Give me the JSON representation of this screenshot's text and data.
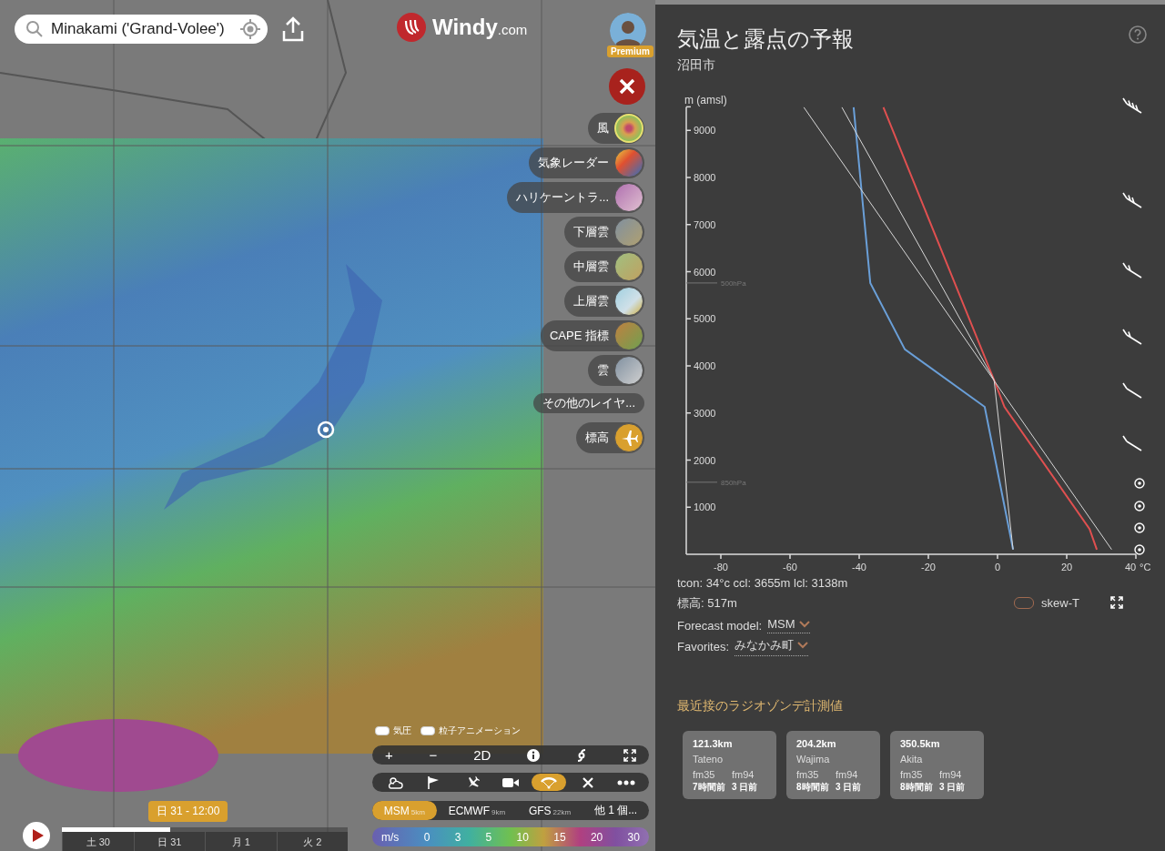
{
  "search": {
    "value": "Minakami ('Grand-Volee')"
  },
  "logo": {
    "name": "Windy",
    "suffix": ".com"
  },
  "account": {
    "badge": "Premium"
  },
  "layers": [
    {
      "kind": "layer",
      "label": "風",
      "selected": true
    },
    {
      "kind": "layer",
      "label": "気象レーダー",
      "selected": false
    },
    {
      "kind": "layer",
      "label": "ハリケーントラ...",
      "selected": false
    },
    {
      "kind": "layer",
      "label": "下層雲",
      "selected": false
    },
    {
      "kind": "layer",
      "label": "中層雲",
      "selected": false
    },
    {
      "kind": "layer",
      "label": "上層雲",
      "selected": false
    },
    {
      "kind": "layer",
      "label": "CAPE 指標",
      "selected": false
    },
    {
      "kind": "layer",
      "label": "雲",
      "selected": false
    },
    {
      "kind": "more",
      "label": "その他のレイヤ...",
      "selected": false
    },
    {
      "kind": "altitude",
      "label": "標高",
      "selected": false
    }
  ],
  "overlays": [
    {
      "label": "気圧",
      "on": true
    },
    {
      "label": "粒子アニメーション",
      "on": true
    }
  ],
  "map_controls": {
    "zoom_in": "+",
    "zoom_out": "−",
    "view_mode": "2D"
  },
  "tools": [
    {
      "kind": "weather",
      "selected": false
    },
    {
      "kind": "flag",
      "selected": false
    },
    {
      "kind": "plane",
      "selected": false
    },
    {
      "kind": "camera",
      "selected": false
    },
    {
      "kind": "paraglider",
      "selected": true
    },
    {
      "kind": "close",
      "selected": false
    },
    {
      "kind": "more",
      "selected": false
    }
  ],
  "models": [
    {
      "name": "MSM",
      "resolution": "5km",
      "selected": true
    },
    {
      "name": "ECMWF",
      "resolution": "9km",
      "selected": false
    },
    {
      "name": "GFS",
      "resolution": "22km",
      "selected": false
    },
    {
      "name": "他 1 個...",
      "selected": false
    }
  ],
  "legend": {
    "unit": "m/s",
    "values": [
      "0",
      "3",
      "5",
      "10",
      "15",
      "20",
      "30"
    ]
  },
  "timeline": {
    "tooltip": "日 31 - 12:00",
    "level": 0.38,
    "days": [
      "土 30",
      "日 31",
      "月 1",
      "火 2"
    ]
  },
  "panel": {
    "title": "気温と露点の予報",
    "subtitle": "沼田市",
    "chart_data": {
      "type": "line",
      "xlabel": "°C",
      "ylabel": "m (amsl)",
      "series": [
        {
          "color": "#e05050",
          "x": [
            28.7,
            26.6,
            2,
            -1,
            -33
          ],
          "values": [
            100,
            540,
            3130,
            3700,
            9490
          ]
        },
        {
          "color": "#6a9fd8",
          "x": [
            4.5,
            -3.7,
            -26.8,
            -36.8,
            -41.6
          ],
          "values": [
            100,
            3130,
            4350,
            5760,
            9490
          ]
        },
        {
          "color": "#d8d8d8",
          "x": [
            33,
            -56
          ],
          "values": [
            100,
            9490
          ]
        },
        {
          "color": "#d8d8d8",
          "x": [
            4.5,
            -1,
            -45
          ],
          "values": [
            100,
            3700,
            9490
          ]
        }
      ],
      "xlim": [
        -90,
        40
      ],
      "ylim": [
        0,
        9500
      ],
      "xticks": [
        -80,
        -60,
        -40,
        -20,
        0,
        20,
        40
      ],
      "yticks": [
        1000,
        2000,
        3000,
        4000,
        5000,
        6000,
        7000,
        8000,
        9000
      ],
      "ref_lines": [
        {
          "axis": "y",
          "value": 5760,
          "label": "500hPa"
        },
        {
          "axis": "y",
          "value": 1530,
          "label": "850hPa"
        }
      ]
    },
    "stats": [
      "tcon: 34°c ccl: 3655m lcl: 3138m",
      "標高: 517m"
    ],
    "skew_t": {
      "label": "skew-T",
      "on": false
    },
    "forecast_model": {
      "label": "Forecast model:",
      "value": "MSM"
    },
    "favorites": {
      "label": "Favorites:",
      "value": "みなかみ町"
    },
    "soundings": {
      "heading": "最近接のラジオゾンデ計測値",
      "stations": [
        {
          "distance": "121.3km",
          "name": "Tateno",
          "left_type": "fm35",
          "left_age": "7時間前",
          "right_type": "fm94",
          "right_age": "3 日前"
        },
        {
          "distance": "204.2km",
          "name": "Wajima",
          "left_type": "fm35",
          "left_age": "8時間前",
          "right_type": "fm94",
          "right_age": "3 日前"
        },
        {
          "distance": "350.5km",
          "name": "Akita",
          "left_type": "fm35",
          "left_age": "8時間前",
          "right_type": "fm94",
          "right_age": "3 日前"
        }
      ]
    }
  }
}
